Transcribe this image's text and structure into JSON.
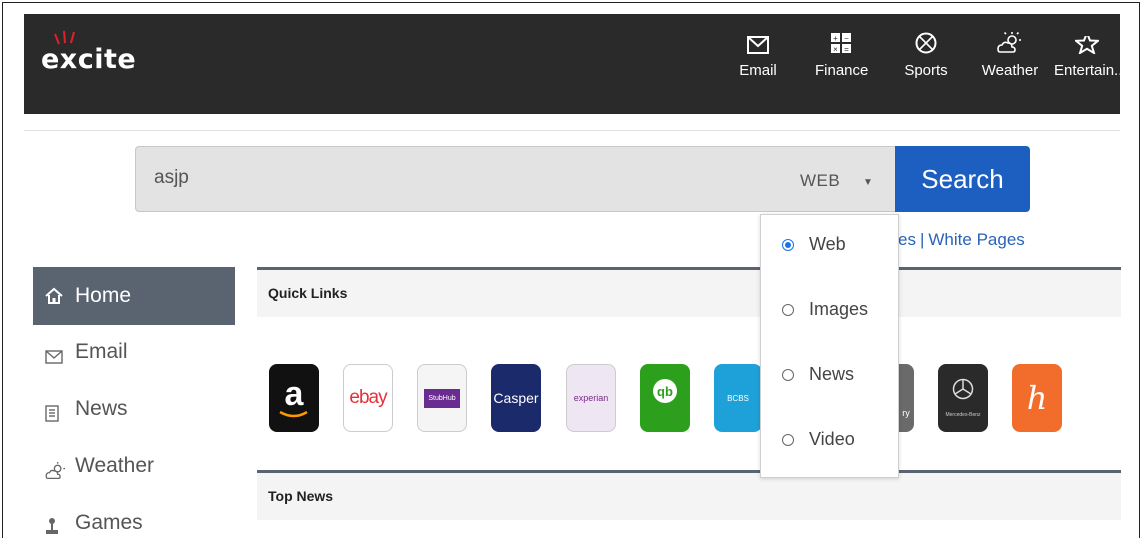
{
  "brand": {
    "logo_text": "excite"
  },
  "nav": [
    {
      "label": "Email",
      "icon": "envelope-icon"
    },
    {
      "label": "Finance",
      "icon": "calculator-icon"
    },
    {
      "label": "Sports",
      "icon": "basketball-icon"
    },
    {
      "label": "Weather",
      "icon": "sun-cloud-icon"
    },
    {
      "label": "Entertain...",
      "icon": "star-icon"
    }
  ],
  "search": {
    "value": "asjp",
    "scope": "WEB",
    "button_label": "Search",
    "links_partial": "es",
    "links_separator": "|",
    "white_pages_label": "White Pages"
  },
  "dropdown": {
    "options": [
      {
        "label": "Web",
        "selected": true
      },
      {
        "label": "Images",
        "selected": false
      },
      {
        "label": "News",
        "selected": false
      },
      {
        "label": "Video",
        "selected": false
      }
    ]
  },
  "sidebar": {
    "items": [
      {
        "label": "Home",
        "icon": "home-icon",
        "active": true
      },
      {
        "label": "Email",
        "icon": "envelope-icon"
      },
      {
        "label": "News",
        "icon": "newspaper-icon"
      },
      {
        "label": "Weather",
        "icon": "sun-cloud-icon"
      },
      {
        "label": "Games",
        "icon": "joystick-icon"
      }
    ]
  },
  "sections": {
    "quick_links_title": "Quick Links",
    "top_news_title": "Top News"
  },
  "quick_links": [
    {
      "name": "amazon",
      "text": "a",
      "bg": "#111111",
      "fg": "#ffffff"
    },
    {
      "name": "ebay",
      "text": "ebay",
      "bg": "#ffffff",
      "fg": "#e53238"
    },
    {
      "name": "stubhub",
      "text": "StubHub",
      "bg": "#f5f5f5",
      "fg": "#ffffff"
    },
    {
      "name": "casper",
      "text": "Casper",
      "bg": "#1b2a6b",
      "fg": "#ffffff"
    },
    {
      "name": "experian",
      "text": "experian",
      "bg": "#efe6f3",
      "fg": "#7a2a8a"
    },
    {
      "name": "quickbooks",
      "text": "qb",
      "bg": "#2ca01c",
      "fg": "#ffffff"
    },
    {
      "name": "blue-cross",
      "text": "BCBS",
      "bg": "#1ea1d8",
      "fg": "#ffffff"
    },
    {
      "name": "partial-green",
      "text": "ry",
      "bg": "#6a6a6a",
      "fg": "#ffffff"
    },
    {
      "name": "mercedes-benz",
      "text": "Mercedes-Benz",
      "bg": "#2a2a2a",
      "fg": "#ffffff"
    },
    {
      "name": "honey",
      "text": "h",
      "bg": "#f26c2b",
      "fg": "#ffffff"
    }
  ],
  "colors": {
    "topbar": "#2a2a2a",
    "accent_blue": "#1d5fc0",
    "sidebar_active": "#5a6470"
  }
}
